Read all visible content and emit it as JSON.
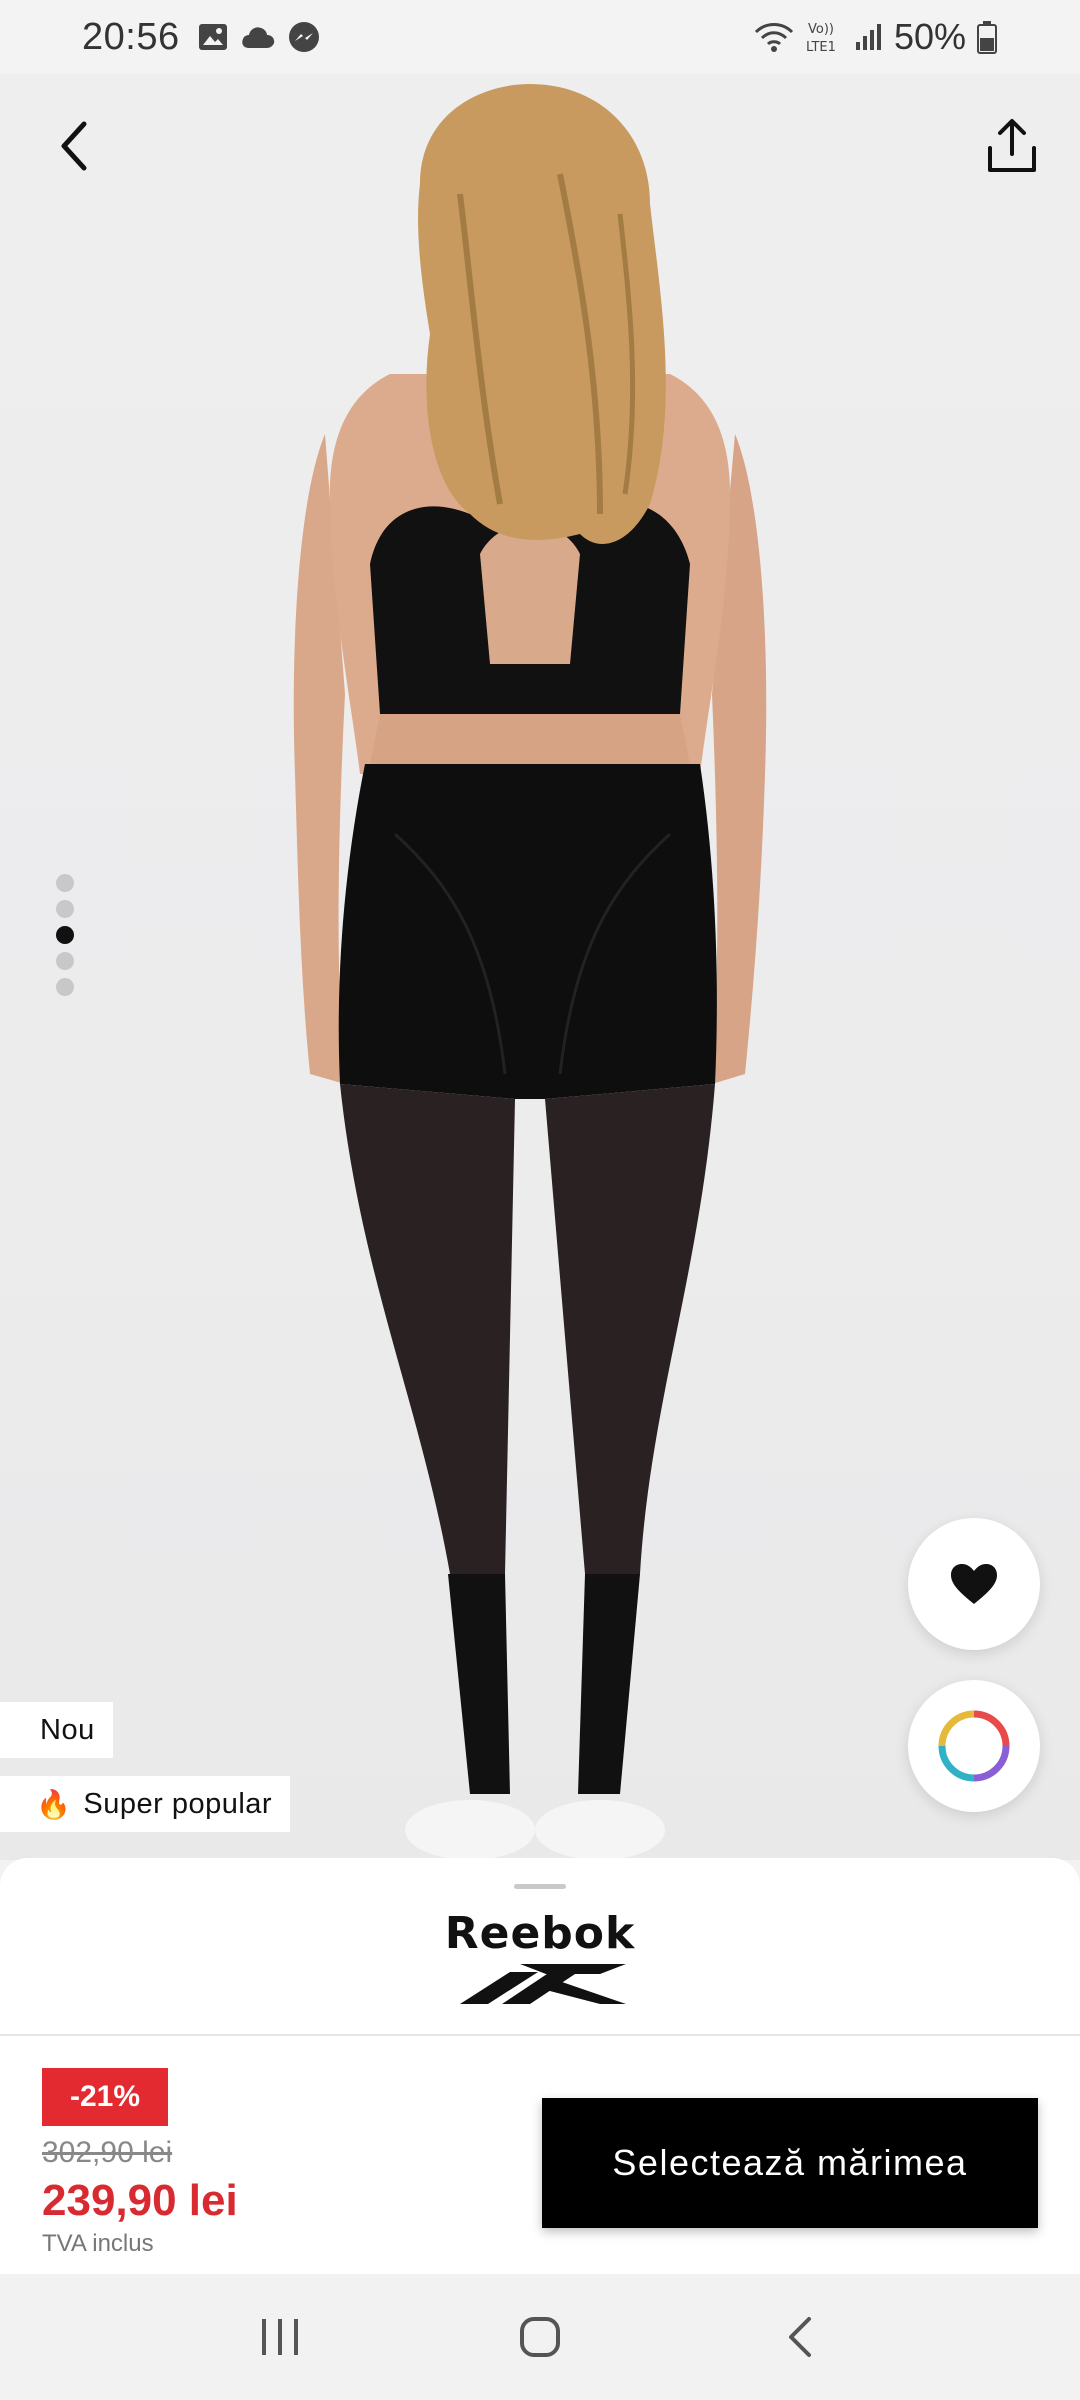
{
  "status_bar": {
    "time": "20:56",
    "battery": "50%",
    "network": "LTE1"
  },
  "hero": {
    "pager_total": 5,
    "pager_active_index": 2
  },
  "tags": {
    "new": "Nou",
    "popular_emoji": "🔥",
    "popular": "Super popular"
  },
  "product": {
    "brand": "Reebok",
    "discount": "-21%",
    "old_price": "302,90 lei",
    "new_price": "239,90 lei",
    "vat_note": "TVA inclus",
    "select_size_label": "Selectează mărimea"
  },
  "colors": {
    "accent_red": "#d82b31",
    "badge_red": "#e32a30",
    "button_black": "#000000"
  },
  "icons": {
    "back": "chevron-left-icon",
    "share": "share-icon",
    "wishlist": "heart-icon",
    "colors": "color-wheel-icon"
  }
}
